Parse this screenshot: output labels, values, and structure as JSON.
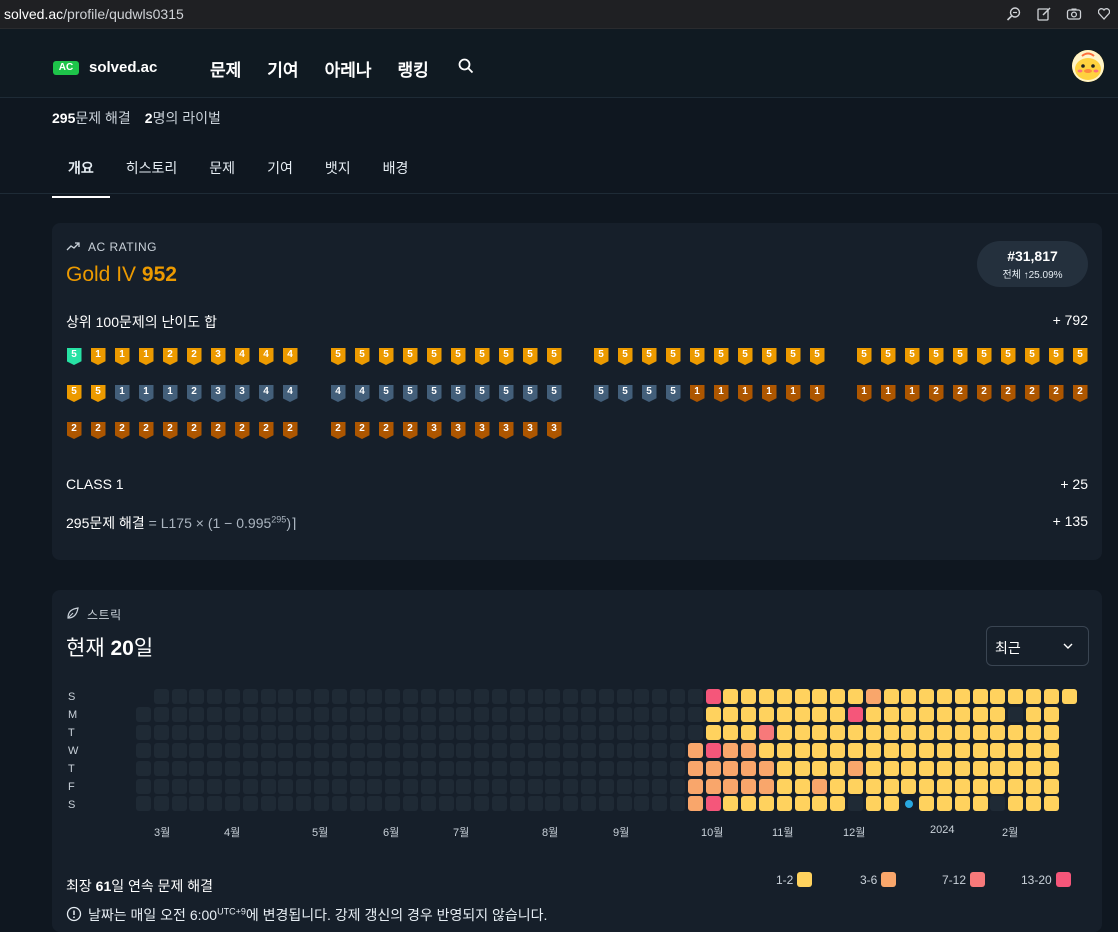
{
  "browser": {
    "url_host": "solved.ac",
    "url_path": "/profile/qudwls0315"
  },
  "nav": {
    "logo_badge": "AC",
    "logo_name": "solved.ac",
    "menu": [
      "문제",
      "기여",
      "아레나",
      "랭킹"
    ]
  },
  "profile": {
    "solved_count": "295",
    "solved_label": "문제 해결",
    "rival_count": "2",
    "rival_label": "명의 라이벌"
  },
  "tabs": [
    "개요",
    "히스토리",
    "문제",
    "기여",
    "뱃지",
    "배경"
  ],
  "active_tab": "개요",
  "rating": {
    "section_label": "AC RATING",
    "tier_name": "Gold IV",
    "rating_value": "952",
    "rank": "#31,817",
    "rank_scope": "전체",
    "rank_percent": "↑25.09%",
    "top100_label": "상위 100문제의 난이도 합",
    "top100_value": "+ 792",
    "class_label": "CLASS 1",
    "class_value": "+ 25",
    "solved_label": "295문제 해결",
    "solved_formula_pre": "= L175 × (1 − 0.995",
    "solved_formula_exp": "295",
    "solved_formula_post": ")⌉",
    "solved_value": "+ 135",
    "badge_groups": [
      [
        "P5",
        "G1",
        "G1",
        "G1",
        "G2",
        "G2",
        "G3",
        "G4",
        "G4",
        "G4",
        "G5",
        "G5",
        "S1",
        "S1",
        "S1",
        "S2",
        "S3",
        "S3",
        "S4",
        "S4",
        "B2",
        "B2",
        "B2",
        "B2",
        "B2",
        "B2",
        "B2",
        "B2",
        "B2",
        "B2"
      ],
      [
        "G5",
        "G5",
        "G5",
        "G5",
        "G5",
        "G5",
        "G5",
        "G5",
        "G5",
        "G5",
        "S4",
        "S4",
        "S5",
        "S5",
        "S5",
        "S5",
        "S5",
        "S5",
        "S5",
        "S5",
        "B2",
        "B2",
        "B2",
        "B2",
        "B3",
        "B3",
        "B3",
        "B3",
        "B3",
        "B3"
      ],
      [
        "G5",
        "G5",
        "G5",
        "G5",
        "G5",
        "G5",
        "G5",
        "G5",
        "G5",
        "G5",
        "S5",
        "S5",
        "S5",
        "S5",
        "B1",
        "B1",
        "B1",
        "B1",
        "B1",
        "B1"
      ],
      [
        "G5",
        "G5",
        "G5",
        "G5",
        "G5",
        "G5",
        "G5",
        "G5",
        "G5",
        "G5",
        "B1",
        "B1",
        "B1",
        "B2",
        "B2",
        "B2",
        "B2",
        "B2",
        "B2",
        "B2"
      ]
    ]
  },
  "streak": {
    "section_label": "스트릭",
    "current_prefix": "현재 ",
    "current_value": "20",
    "current_suffix": "일",
    "select_value": "최근",
    "day_labels": [
      "S",
      "M",
      "T",
      "W",
      "T",
      "F",
      "S"
    ],
    "months": [
      "3월",
      "4월",
      "5월",
      "6월",
      "7월",
      "8월",
      "9월",
      "10월",
      "11월",
      "12월",
      "2024",
      "2월"
    ],
    "max_prefix": "최장 ",
    "max_value": "61",
    "max_suffix": "일 연속 문제 해결",
    "legend": [
      {
        "label": "1-2",
        "color": "#ffd25e"
      },
      {
        "label": "3-6",
        "color": "#f9a66b"
      },
      {
        "label": "7-12",
        "color": "#f7797a"
      },
      {
        "label": "13-20",
        "color": "#f5567a"
      }
    ],
    "note_pre": "날짜는 매일 오전 6:00",
    "note_sup": "UTC+9",
    "note_post": "에 변경됩니다. 강제 갱신의 경우 반영되지 않습니다."
  },
  "colors": {
    "empty": "#1f2a35",
    "accent_green": "#1ec44a",
    "gold": "#ec9a00"
  }
}
